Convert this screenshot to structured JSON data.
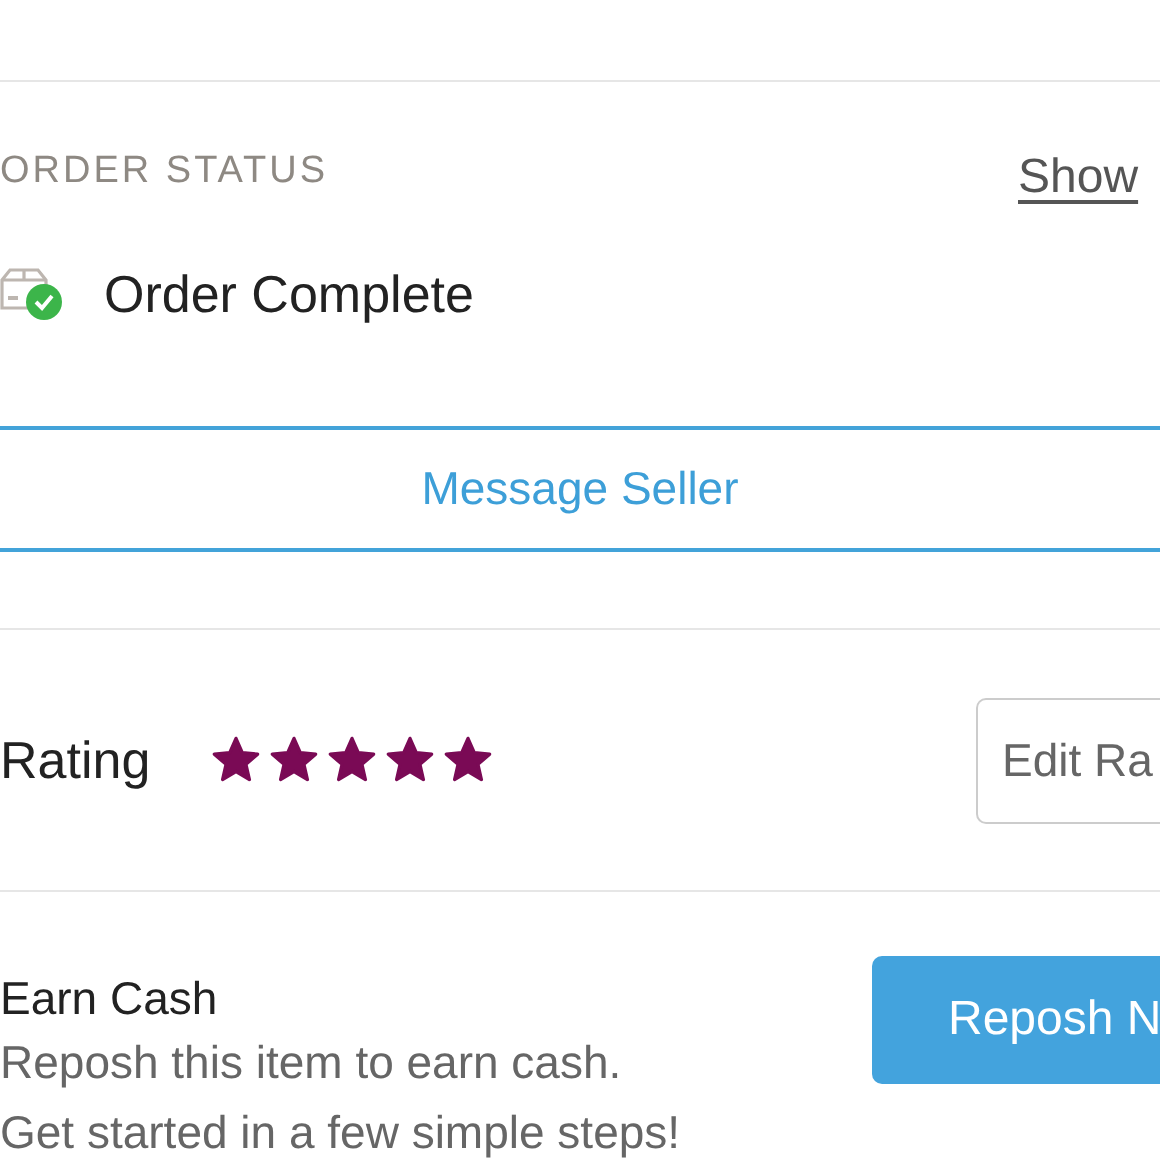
{
  "order_status": {
    "heading": "ORDER STATUS",
    "link": "Show",
    "status": "Order Complete",
    "message_button": "Message Seller"
  },
  "rating": {
    "label": "Rating",
    "stars": 5,
    "button": "Edit Ra"
  },
  "earn_cash": {
    "title": "Earn Cash",
    "lines": [
      "Reposh this item to earn cash.",
      "Get started in a few simple steps!"
    ],
    "button": "Reposh N"
  }
}
